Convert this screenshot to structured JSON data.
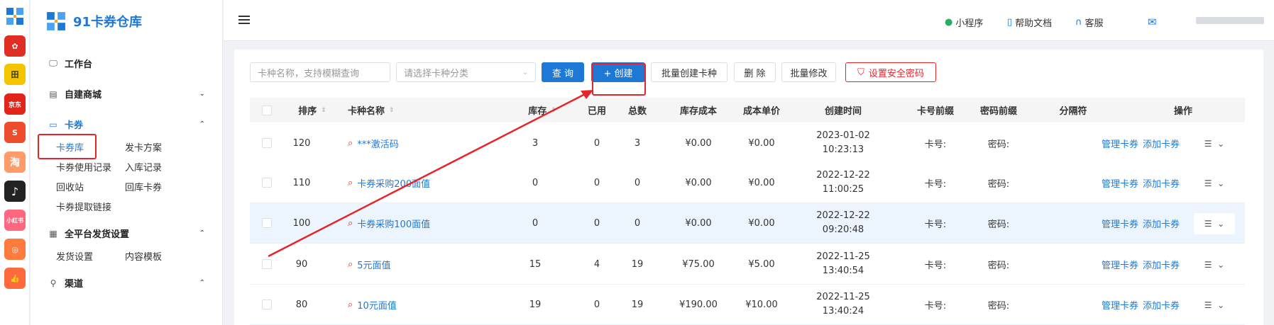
{
  "rail": {
    "icons": [
      {
        "name": "app-logo-icon",
        "color": "#1e78d6",
        "label": ""
      },
      {
        "name": "pinduoduo-icon",
        "color": "#e02e24",
        "label": ""
      },
      {
        "name": "yuanbao-icon",
        "color": "#f5c400",
        "label": "田"
      },
      {
        "name": "jd-icon",
        "color": "#e1251b",
        "label": "京东"
      },
      {
        "name": "shopee-icon",
        "color": "#ee4d2d",
        "label": "S"
      },
      {
        "name": "taobao-icon",
        "color": "#ff9a6b",
        "label": "淘"
      },
      {
        "name": "tiktok-icon",
        "color": "#222",
        "label": "♪"
      },
      {
        "name": "xiaohongshu-icon",
        "color": "#ff6680",
        "label": "小红书"
      },
      {
        "name": "kuaishou-icon",
        "color": "#ff7a3d",
        "label": ""
      },
      {
        "name": "like-icon",
        "color": "#ff6a3d",
        "label": "👍"
      }
    ]
  },
  "sidebar": {
    "brand": "91卡券仓库",
    "groups": [
      {
        "label": "工作台",
        "icon": "monitor-icon"
      },
      {
        "label": "自建商城",
        "icon": "store-icon"
      },
      {
        "label": "卡券",
        "icon": "card-icon"
      },
      {
        "label": "全平台发货设置",
        "icon": "grid-icon"
      },
      {
        "label": "渠道",
        "icon": "channel-icon"
      }
    ],
    "card_subs": [
      "卡券库",
      "发卡方案",
      "卡券使用记录",
      "入库记录",
      "回收站",
      "回库卡券",
      "卡券提取链接"
    ],
    "shipping_subs": [
      "发货设置",
      "内容模板"
    ]
  },
  "header": {
    "miniprogram": "小程序",
    "help": "帮助文档",
    "service": "客服"
  },
  "toolbar": {
    "search_placeholder": "卡种名称，支持模糊查询",
    "category_placeholder": "请选择卡种分类",
    "query": "查 询",
    "create": "+ 创建",
    "batch_create": "批量创建卡种",
    "delete": "删 除",
    "batch_edit": "批量修改",
    "security": "设置安全密码"
  },
  "table": {
    "headers": {
      "order": "排序",
      "name": "卡种名称",
      "stock": "库存",
      "used": "已用",
      "total": "总数",
      "stock_cost": "库存成本",
      "unit_cost": "成本单价",
      "created": "创建时间",
      "card_prefix": "卡号前缀",
      "pwd_prefix": "密码前缀",
      "separator": "分隔符",
      "actions": "操作"
    },
    "rows": [
      {
        "order": "120",
        "name": "***激活码",
        "stock": "3",
        "used": "0",
        "total": "3",
        "stock_cost": "¥0.00",
        "unit_cost": "¥0.00",
        "date": "2023-01-02",
        "time": "10:23:13",
        "card": "卡号:",
        "pwd": "密码:",
        "manage": "管理卡券",
        "add": "添加卡券"
      },
      {
        "order": "110",
        "name": "卡券采购200面值",
        "stock": "0",
        "used": "0",
        "total": "0",
        "stock_cost": "¥0.00",
        "unit_cost": "¥0.00",
        "date": "2022-12-22",
        "time": "11:00:25",
        "card": "卡号:",
        "pwd": "密码:",
        "manage": "管理卡券",
        "add": "添加卡券"
      },
      {
        "order": "100",
        "name": "卡券采购100面值",
        "stock": "0",
        "used": "0",
        "total": "0",
        "stock_cost": "¥0.00",
        "unit_cost": "¥0.00",
        "date": "2022-12-22",
        "time": "09:20:48",
        "card": "卡号:",
        "pwd": "密码:",
        "manage": "管理卡券",
        "add": "添加卡券"
      },
      {
        "order": "90",
        "name": "5元面值",
        "stock": "15",
        "used": "4",
        "total": "19",
        "stock_cost": "¥75.00",
        "unit_cost": "¥5.00",
        "date": "2022-11-25",
        "time": "13:40:54",
        "card": "卡号:",
        "pwd": "密码:",
        "manage": "管理卡券",
        "add": "添加卡券"
      },
      {
        "order": "80",
        "name": "10元面值",
        "stock": "19",
        "used": "0",
        "total": "19",
        "stock_cost": "¥190.00",
        "unit_cost": "¥10.00",
        "date": "2022-11-25",
        "time": "13:40:24",
        "card": "卡号:",
        "pwd": "密码:",
        "manage": "管理卡券",
        "add": "添加卡券"
      }
    ]
  },
  "colors": {
    "accent": "#1e78d6",
    "annotation": "#e8242b",
    "highlight_row": "#ecf5fd"
  }
}
